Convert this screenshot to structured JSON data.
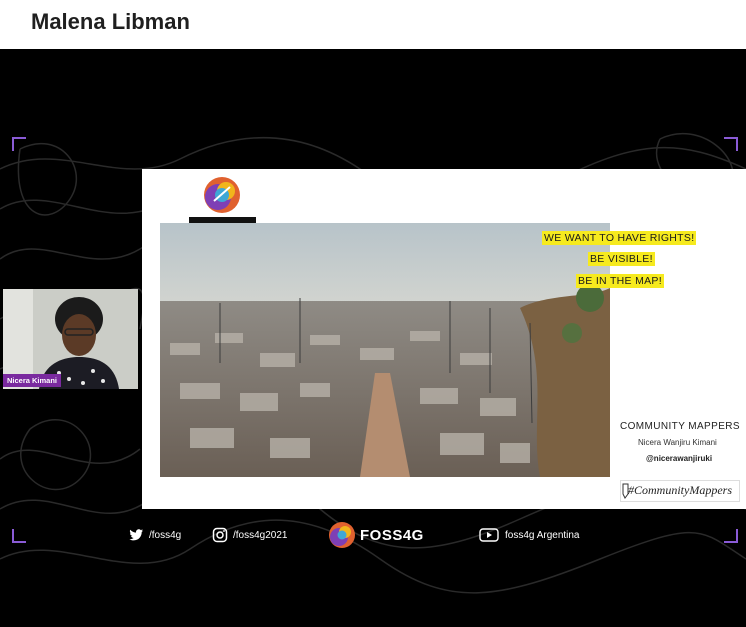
{
  "header": {
    "presenter_name": "Malena Libman"
  },
  "slide": {
    "headline_lines": [
      "WE WANT TO HAVE RIGHTS!",
      "BE VISIBLE!",
      "BE IN THE MAP!"
    ],
    "community_title": "COMMUNITY MAPPERS",
    "speaker_name": "Nicera Wanjiru Kimani",
    "speaker_handle": "@nicerawanjiruki",
    "brand_tag": "#CommunityMappers"
  },
  "webcam": {
    "participant_name": "Nicera Kimani"
  },
  "footer": {
    "twitter": "/foss4g",
    "instagram": "/foss4g2021",
    "logo_text": "FOSS4G",
    "youtube": "foss4g Argentina"
  },
  "colors": {
    "accent_purple": "#8a5bd6",
    "highlight_yellow": "#f6ea1e",
    "label_purple": "#7a2a9f"
  }
}
